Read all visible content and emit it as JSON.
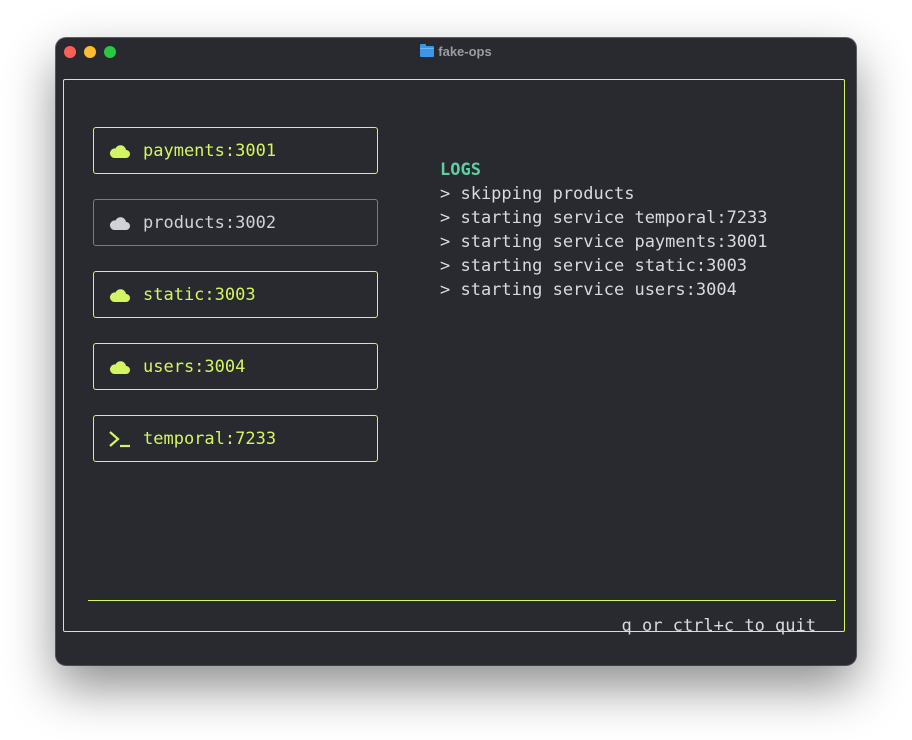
{
  "window": {
    "title": "fake-ops"
  },
  "colors": {
    "accent": "#d4f562",
    "inactive_border": "#7a7c82",
    "logs_title": "#5ecfa0",
    "background": "#282a30"
  },
  "services": [
    {
      "label": "payments:3001",
      "icon": "cloud-icon",
      "active": true
    },
    {
      "label": "products:3002",
      "icon": "cloud-icon",
      "active": false
    },
    {
      "label": "static:3003",
      "icon": "cloud-icon",
      "active": true
    },
    {
      "label": "users:3004",
      "icon": "cloud-icon",
      "active": true
    },
    {
      "label": "temporal:7233",
      "icon": "terminal-icon",
      "active": true
    }
  ],
  "logs": {
    "title": "LOGS",
    "lines": [
      "> skipping products",
      "> starting service temporal:7233",
      "> starting service payments:3001",
      "> starting service static:3003",
      "> starting service users:3004"
    ]
  },
  "footer": {
    "hint": "q or ctrl+c to quit"
  }
}
